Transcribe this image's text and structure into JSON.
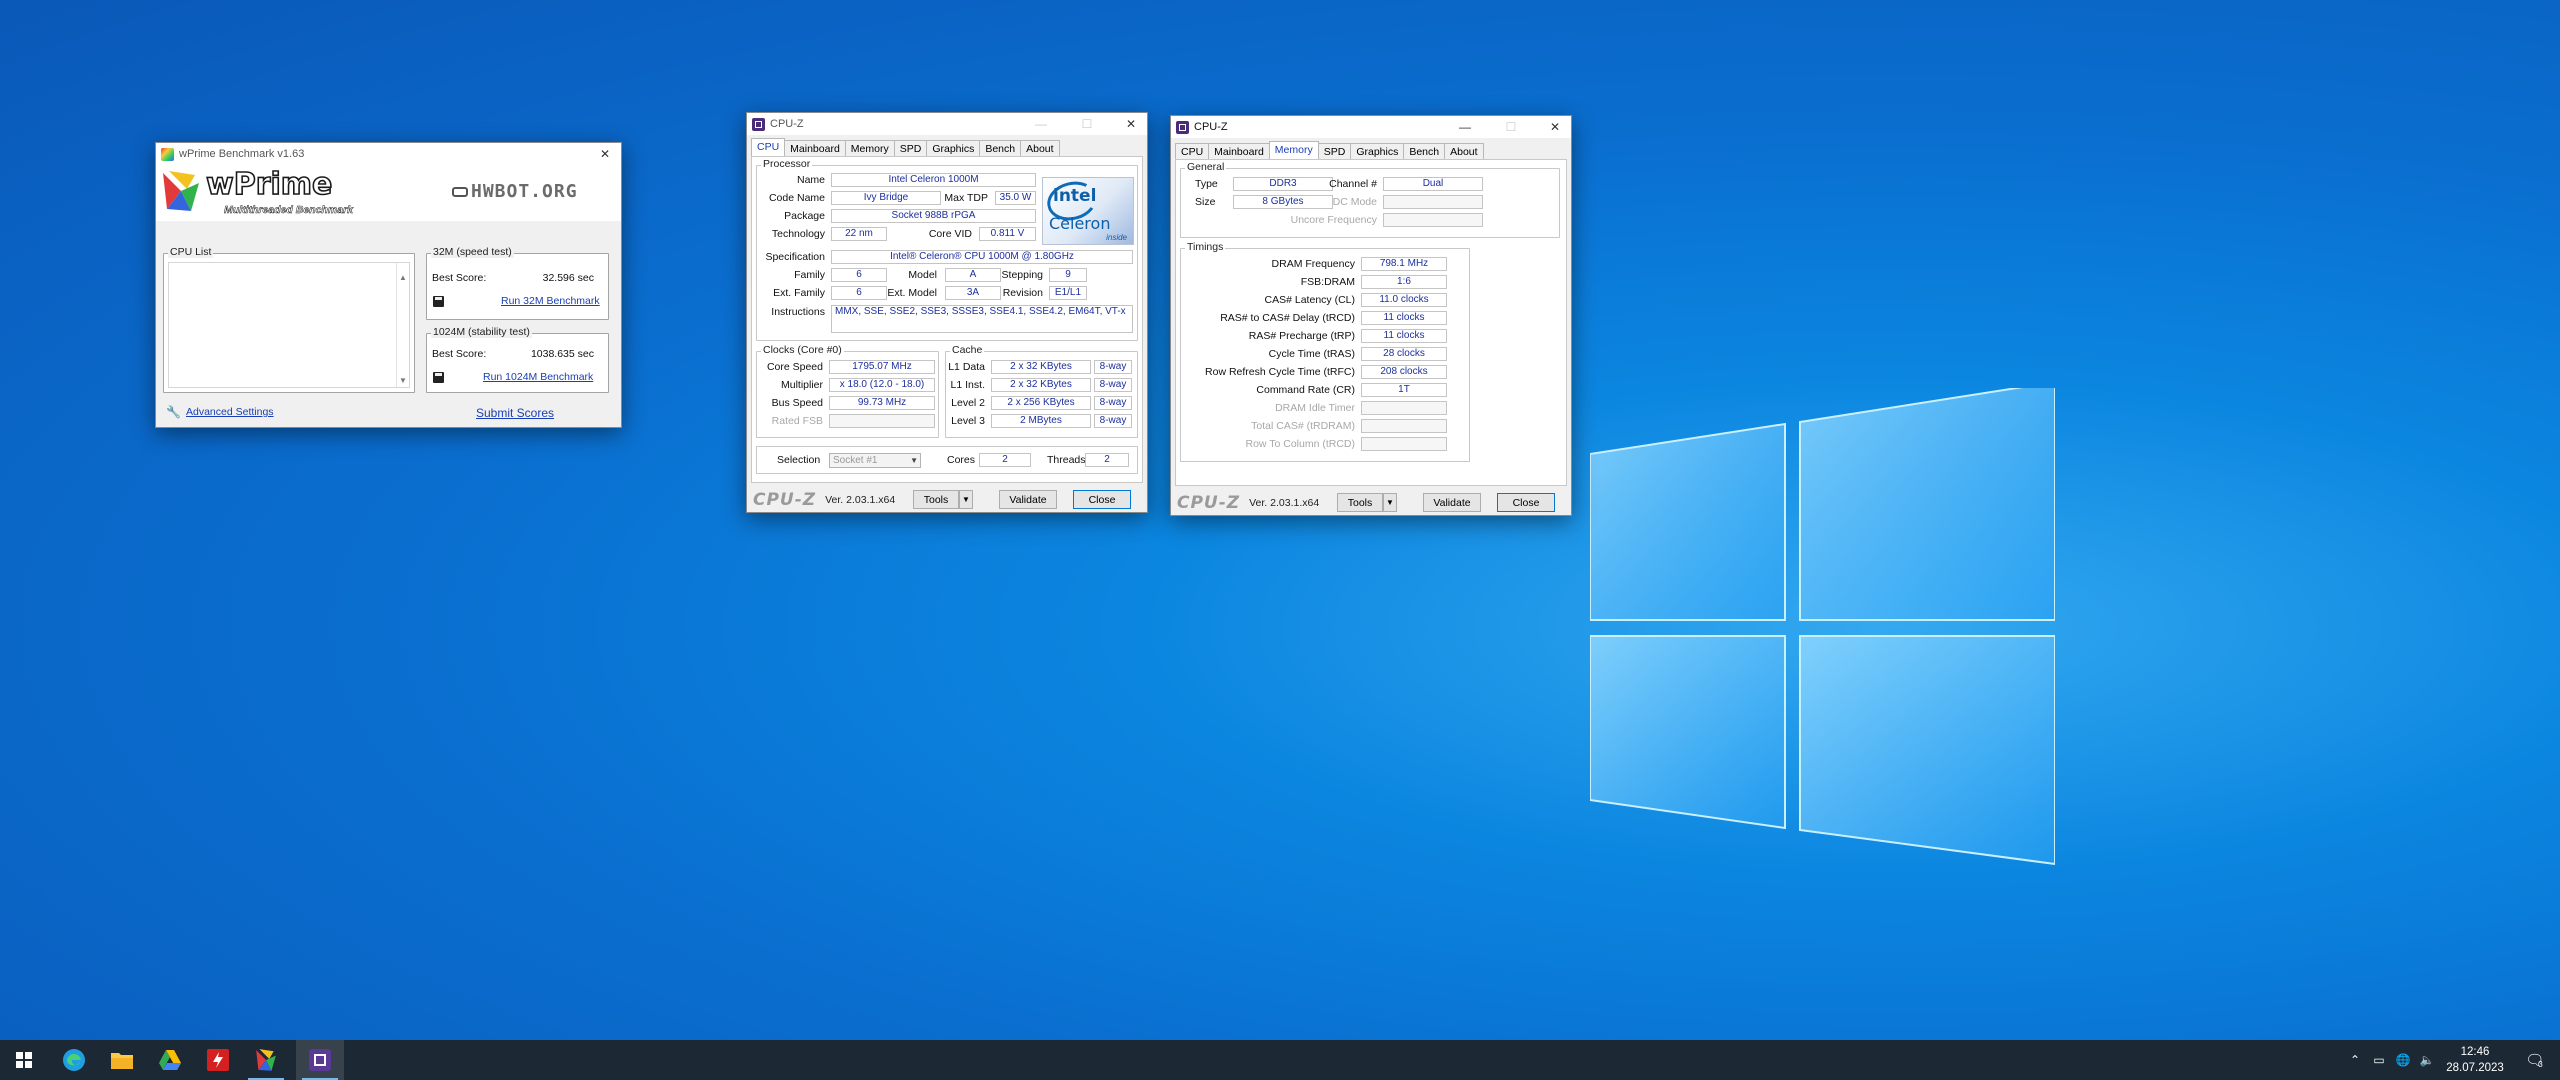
{
  "wprime": {
    "title": "wPrime Benchmark v1.63",
    "logo": "wPrime",
    "logo_sub": "Multithreaded Benchmark",
    "hwbot": "HWBOT.ORG",
    "cpu_list_label": "CPU List",
    "test32_label": "32M (speed test)",
    "test32_best_label": "Best Score:",
    "test32_best_value": "32.596 sec",
    "test32_run": "Run 32M Benchmark",
    "test1024_label": "1024M (stability test)",
    "test1024_best_label": "Best Score:",
    "test1024_best_value": "1038.635 sec",
    "test1024_run": "Run 1024M Benchmark",
    "advanced": "Advanced Settings",
    "submit": "Submit Scores"
  },
  "cpuz_cpu": {
    "title": "CPU-Z",
    "tabs": [
      "CPU",
      "Mainboard",
      "Memory",
      "SPD",
      "Graphics",
      "Bench",
      "About"
    ],
    "active_tab": "CPU",
    "processor_label": "Processor",
    "name_label": "Name",
    "name": "Intel Celeron 1000M",
    "codename_label": "Code Name",
    "codename": "Ivy Bridge",
    "maxtdp_label": "Max TDP",
    "maxtdp": "35.0 W",
    "package_label": "Package",
    "package": "Socket 988B rPGA",
    "technology_label": "Technology",
    "technology": "22 nm",
    "corevid_label": "Core VID",
    "corevid": "0.811 V",
    "spec_label": "Specification",
    "spec": "Intel® Celeron® CPU 1000M @ 1.80GHz",
    "family_label": "Family",
    "family": "6",
    "model_label": "Model",
    "model": "A",
    "stepping_label": "Stepping",
    "stepping": "9",
    "extfamily_label": "Ext. Family",
    "extfamily": "6",
    "extmodel_label": "Ext. Model",
    "extmodel": "3A",
    "revision_label": "Revision",
    "revision": "E1/L1",
    "instructions_label": "Instructions",
    "instructions": "MMX, SSE, SSE2, SSE3, SSSE3, SSE4.1, SSE4.2, EM64T, VT-x",
    "intel_logo": {
      "brand": "intel",
      "line": "Celeron",
      "sub": "inside"
    },
    "clocks_label": "Clocks (Core #0)",
    "corespeed_label": "Core Speed",
    "corespeed": "1795.07 MHz",
    "multiplier_label": "Multiplier",
    "multiplier": "x 18.0 (12.0 - 18.0)",
    "busspeed_label": "Bus Speed",
    "busspeed": "99.73 MHz",
    "ratedfsb_label": "Rated FSB",
    "ratedfsb": "",
    "cache_label": "Cache",
    "l1d_label": "L1 Data",
    "l1d": "2 x 32 KBytes",
    "l1d_way": "8-way",
    "l1i_label": "L1 Inst.",
    "l1i": "2 x 32 KBytes",
    "l1i_way": "8-way",
    "l2_label": "Level 2",
    "l2": "2 x 256 KBytes",
    "l2_way": "8-way",
    "l3_label": "Level 3",
    "l3": "2 MBytes",
    "l3_way": "8-way",
    "selection_label": "Selection",
    "selection": "Socket #1",
    "cores_label": "Cores",
    "cores": "2",
    "threads_label": "Threads",
    "threads": "2",
    "brand": "CPU-Z",
    "version": "Ver. 2.03.1.x64",
    "tools": "Tools",
    "validate": "Validate",
    "close": "Close"
  },
  "cpuz_mem": {
    "title": "CPU-Z",
    "tabs": [
      "CPU",
      "Mainboard",
      "Memory",
      "SPD",
      "Graphics",
      "Bench",
      "About"
    ],
    "active_tab": "Memory",
    "general_label": "General",
    "type_label": "Type",
    "type": "DDR3",
    "channel_label": "Channel #",
    "channel": "Dual",
    "size_label": "Size",
    "size": "8 GBytes",
    "dcmode_label": "DC Mode",
    "uncore_label": "Uncore Frequency",
    "timings_label": "Timings",
    "dram_freq_label": "DRAM Frequency",
    "dram_freq": "798.1 MHz",
    "fsb_dram_label": "FSB:DRAM",
    "fsb_dram": "1:6",
    "cas_label": "CAS# Latency (CL)",
    "cas": "11.0 clocks",
    "trcd_label": "RAS# to CAS# Delay (tRCD)",
    "trcd": "11 clocks",
    "trp_label": "RAS# Precharge (tRP)",
    "trp": "11 clocks",
    "tras_label": "Cycle Time (tRAS)",
    "tras": "28 clocks",
    "trfc_label": "Row Refresh Cycle Time (tRFC)",
    "trfc": "208 clocks",
    "cr_label": "Command Rate (CR)",
    "cr": "1T",
    "idle_label": "DRAM Idle Timer",
    "totalcas_label": "Total CAS# (tRDRAM)",
    "rowcol_label": "Row To Column (tRCD)",
    "brand": "CPU-Z",
    "version": "Ver. 2.03.1.x64",
    "tools": "Tools",
    "validate": "Validate",
    "close": "Close"
  },
  "taskbar": {
    "time": "12:46",
    "date": "28.07.2023",
    "notification_count": "3",
    "pinned": [
      "start-icon",
      "edge-icon",
      "file-explorer-icon",
      "google-drive-icon",
      "red-app-icon",
      "wprime-icon",
      "cpuz-icon"
    ]
  },
  "colors": {
    "desktop": "#0a6fd0",
    "taskbar": "#1c2834",
    "value_text": "#1d2f9c",
    "link": "#1a3fb5"
  }
}
